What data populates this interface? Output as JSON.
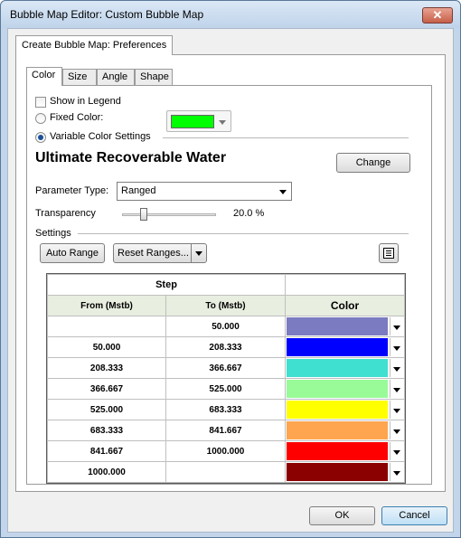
{
  "window": {
    "title": "Bubble Map Editor: Custom Bubble Map",
    "close_label": "✕"
  },
  "outer_tab": {
    "label": "Create Bubble Map: Preferences"
  },
  "inner_tabs": [
    {
      "label": "Color",
      "active": true
    },
    {
      "label": "Size",
      "active": false
    },
    {
      "label": "Angle",
      "active": false
    },
    {
      "label": "Shape",
      "active": false
    }
  ],
  "legend": {
    "label": "Show in Legend",
    "checked": false
  },
  "fixed_color": {
    "label": "Fixed Color:",
    "selected": false,
    "swatch": "#00ff00"
  },
  "variable_color": {
    "label": "Variable Color Settings",
    "selected": true
  },
  "parameter": {
    "name": "Ultimate Recoverable Water",
    "change_label": "Change"
  },
  "parameter_type": {
    "label": "Parameter Type:",
    "value": "Ranged"
  },
  "transparency": {
    "label": "Transparency",
    "value": "20.0 %",
    "level": 0.2
  },
  "settings": {
    "label": "Settings",
    "auto_range_label": "Auto Range",
    "reset_label": "Reset Ranges...",
    "menu_icon": "list-menu-icon"
  },
  "grid": {
    "step_header": "Step",
    "col_from": "From (Mstb)",
    "col_to": "To (Mstb)",
    "col_color": "Color",
    "rows": [
      {
        "from": "",
        "to": "50.000",
        "color": "#7b7bc1"
      },
      {
        "from": "50.000",
        "to": "208.333",
        "color": "#0000ff"
      },
      {
        "from": "208.333",
        "to": "366.667",
        "color": "#40e0d0"
      },
      {
        "from": "366.667",
        "to": "525.000",
        "color": "#98fb98"
      },
      {
        "from": "525.000",
        "to": "683.333",
        "color": "#ffff00"
      },
      {
        "from": "683.333",
        "to": "841.667",
        "color": "#ffa54f"
      },
      {
        "from": "841.667",
        "to": "1000.000",
        "color": "#ff0000"
      },
      {
        "from": "1000.000",
        "to": "",
        "color": "#8b0000"
      }
    ]
  },
  "buttons": {
    "ok": "OK",
    "cancel": "Cancel"
  }
}
